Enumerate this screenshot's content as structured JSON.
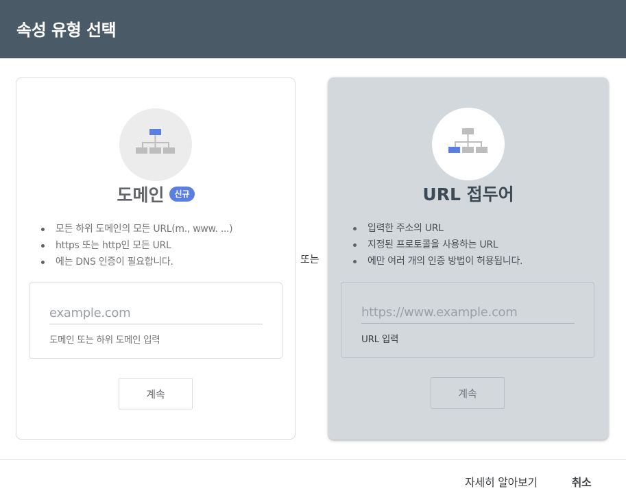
{
  "dialog": {
    "title": "속성 유형 선택"
  },
  "domain_card": {
    "title": "도메인",
    "badge": "신규",
    "features": [
      "모든 하위 도메인의 모든 URL(m., www. ...)",
      "https 또는 http인 모든 URL",
      "에는 DNS 인증이 필요합니다."
    ],
    "input_placeholder": "example.com",
    "input_value": "",
    "input_hint": "도메인 또는 하위 도메인 입력",
    "continue_label": "계속",
    "icon": "sitemap-icon"
  },
  "or_label": "또는",
  "url_card": {
    "title": "URL 접두어",
    "features": [
      "입력한 주소의 URL",
      "지정된 프로토콜을 사용하는 URL",
      "에만 여러 개의 인증 방법이 허용됩니다."
    ],
    "input_placeholder": "https://www.example.com",
    "input_value": "",
    "input_hint": "URL 입력",
    "continue_label": "계속",
    "icon": "sitemap-icon"
  },
  "footer": {
    "learn_more_label": "자세히 알아보기",
    "cancel_label": "취소"
  },
  "colors": {
    "header_bg": "#4a5a66",
    "highlight_blue": "#5b7fe0",
    "selected_card_bg": "#d2d8dc",
    "icon_gray": "#bdbdbd"
  }
}
